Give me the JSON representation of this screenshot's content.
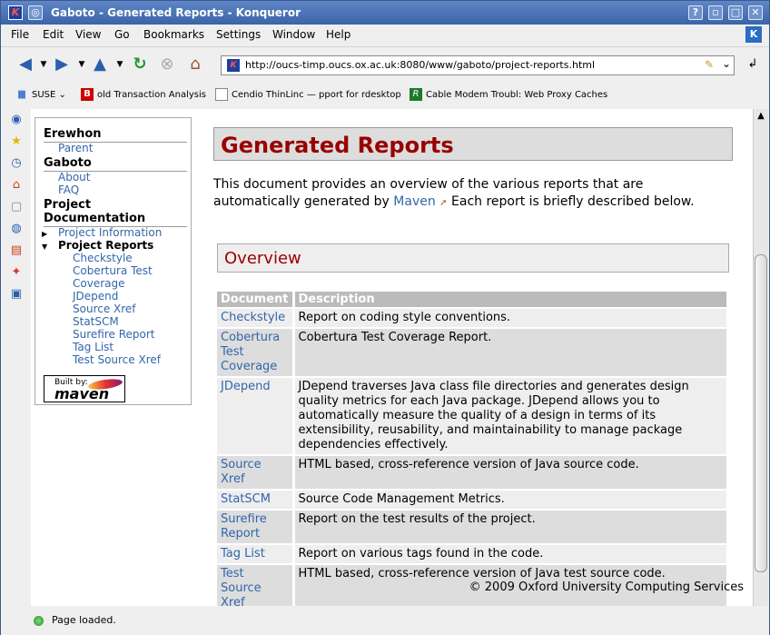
{
  "window": {
    "title": "Gaboto - Generated Reports - Konqueror"
  },
  "menu": [
    "File",
    "Edit",
    "View",
    "Go",
    "Bookmarks",
    "Settings",
    "Window",
    "Help"
  ],
  "location": {
    "url": "http://oucs-timp.oucs.ox.ac.uk:8080/www/gaboto/project-reports.html"
  },
  "bookmarks": [
    {
      "label": "SUSE",
      "icon": "folder-icon"
    },
    {
      "label": "old Transaction Analysis",
      "icon": "bookmark-b-icon"
    },
    {
      "label": "Cendio ThinLinc — pport for rdesktop",
      "icon": "page-icon"
    },
    {
      "label": "Cable Modem Troubl: Web Proxy Caches",
      "icon": "r-icon"
    }
  ],
  "nav": {
    "erewhon": "Erewhon",
    "parent": "Parent",
    "gaboto": "Gaboto",
    "about": "About",
    "faq": "FAQ",
    "project_documentation_line1": "Project",
    "project_documentation_line2": "Documentation",
    "project_information": "Project Information",
    "project_reports": "Project Reports",
    "reports": [
      "Checkstyle",
      "Cobertura Test",
      "Coverage",
      "JDepend",
      "Source Xref",
      "StatSCM",
      "Surefire Report",
      "Tag List",
      "Test Source Xref"
    ],
    "built_by": "Built by:",
    "maven": "maven"
  },
  "page": {
    "title": "Generated Reports",
    "intro_before": "This document provides an overview of the various reports that are automatically generated by ",
    "intro_link": "Maven",
    "intro_after": " Each report is briefly described below.",
    "overview": "Overview",
    "table_headers": [
      "Document",
      "Description"
    ],
    "rows": [
      {
        "doc": [
          "Checkstyle"
        ],
        "desc": "Report on coding style conventions."
      },
      {
        "doc": [
          "Cobertura",
          "Test",
          "Coverage"
        ],
        "desc": "Cobertura Test Coverage Report."
      },
      {
        "doc": [
          "JDepend"
        ],
        "desc": "JDepend traverses Java class file directories and generates design quality metrics for each Java package. JDepend allows you to automatically measure the quality of a design in terms of its extensibility, reusability, and maintainability to manage package dependencies effectively."
      },
      {
        "doc": [
          "Source Xref"
        ],
        "desc": "HTML based, cross-reference version of Java source code."
      },
      {
        "doc": [
          "StatSCM"
        ],
        "desc": "Source Code Management Metrics."
      },
      {
        "doc": [
          "Surefire",
          "Report"
        ],
        "desc": "Report on the test results of the project."
      },
      {
        "doc": [
          "Tag List"
        ],
        "desc": "Report on various tags found in the code."
      },
      {
        "doc": [
          "Test",
          "Source Xref"
        ],
        "desc": "HTML based, cross-reference version of Java test source code."
      }
    ],
    "footer": "© 2009 Oxford University Computing Services"
  },
  "status": {
    "text": "Page loaded."
  }
}
